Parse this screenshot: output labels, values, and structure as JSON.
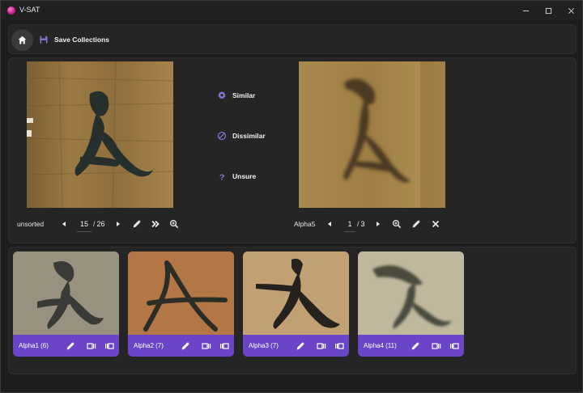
{
  "window": {
    "title": "V-SAT"
  },
  "toolbar": {
    "save_label": "Save Collections"
  },
  "verdicts": {
    "similar": "Similar",
    "dissimilar": "Dissimilar",
    "unsure": "Unsure"
  },
  "left_nav": {
    "collection": "unsorted",
    "current_page": "15",
    "separator": "/",
    "total_pages": "26"
  },
  "right_nav": {
    "collection": "Alpha5",
    "current_page": "1",
    "separator": "/",
    "total_pages": "3"
  },
  "gallery": {
    "cards": [
      {
        "label": "Alpha1 (6)"
      },
      {
        "label": "Alpha2 (7)"
      },
      {
        "label": "Alpha3 (7)"
      },
      {
        "label": "Alpha4 (11)"
      }
    ]
  },
  "colors": {
    "accent": "#6a45c8",
    "panel": "#252525",
    "background": "#1c1c1c"
  },
  "icons": {
    "home": "home-icon",
    "save": "floppy-disk-icon",
    "similar": "gear-icon",
    "dissimilar": "prohibit-icon",
    "unsure": "question-icon",
    "prev": "caret-left-icon",
    "next": "caret-right-icon",
    "edit": "pencil-icon",
    "fast_forward": "double-chevron-right-icon",
    "zoom": "zoom-in-icon",
    "close": "close-icon",
    "view_single": "view-single-icon",
    "view_grid": "view-grid-icon"
  }
}
